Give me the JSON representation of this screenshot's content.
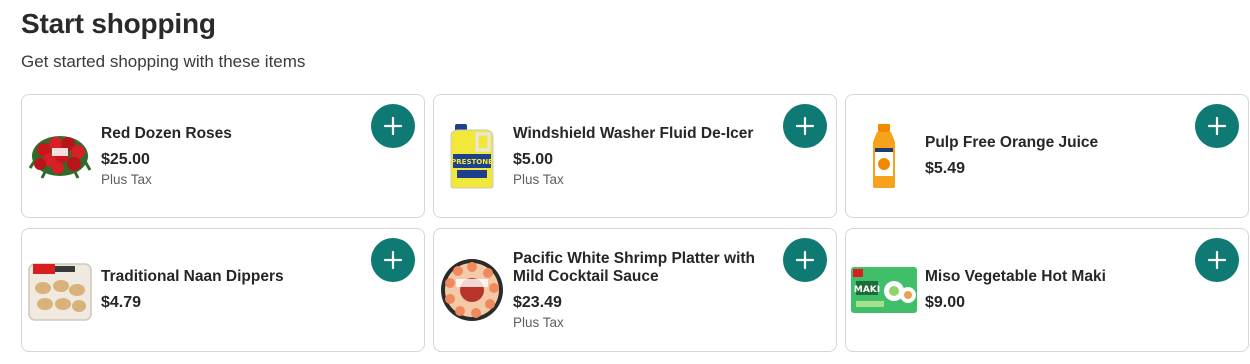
{
  "header": {
    "title": "Start shopping",
    "subtitle": "Get started shopping with these items"
  },
  "colors": {
    "accent": "#0e7a73",
    "card_border": "#d6d6d6"
  },
  "add_icon": "plus-icon",
  "products": [
    {
      "name": "Red Dozen Roses",
      "price": "$25.00",
      "tax": "Plus Tax",
      "image": "roses-image"
    },
    {
      "name": "Windshield Washer Fluid De-Icer",
      "price": "$5.00",
      "tax": "Plus Tax",
      "image": "washer-fluid-jug-image"
    },
    {
      "name": "Pulp Free Orange Juice",
      "price": "$5.49",
      "tax": "",
      "image": "orange-juice-bottle-image"
    },
    {
      "name": "Traditional Naan Dippers",
      "price": "$4.79",
      "tax": "",
      "image": "naan-package-image"
    },
    {
      "name": "Pacific White Shrimp Platter with Mild Cocktail Sauce",
      "price": "$23.49",
      "tax": "Plus Tax",
      "image": "shrimp-platter-image"
    },
    {
      "name": "Miso Vegetable Hot Maki",
      "price": "$9.00",
      "tax": "",
      "image": "maki-box-image"
    }
  ]
}
